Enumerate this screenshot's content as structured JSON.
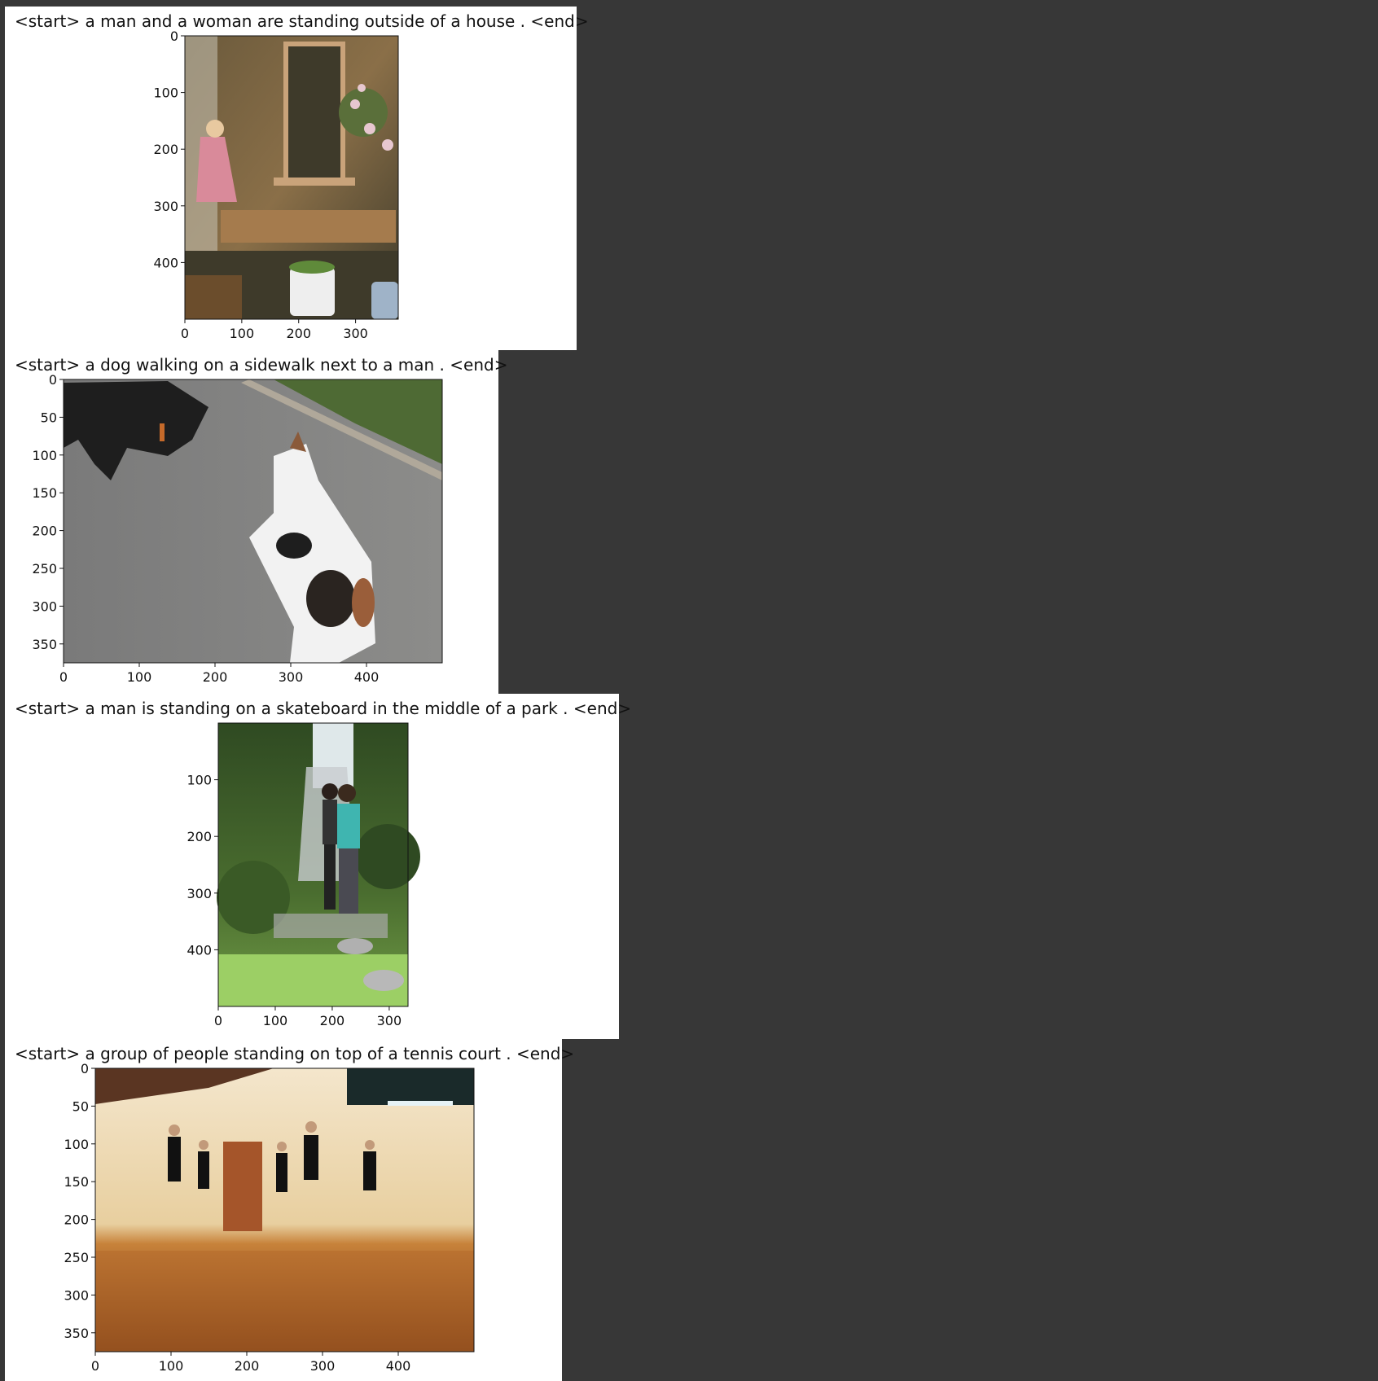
{
  "colors": {
    "background": "#373737",
    "panel": "#ffffff",
    "axis": "#111111"
  },
  "figures": [
    {
      "caption": "<start> a man and a woman are standing outside of a house . <end>",
      "image_subject": "girl in pink dress climbing steps of a wooden cabin porch with flowers and buckets",
      "palette": [
        "#6b5a3c",
        "#8a6f48",
        "#3e3a2a",
        "#c9a37a",
        "#e7c7d0",
        "#5a6f3a"
      ],
      "chart_data": {
        "type": "table",
        "x_ticks": [
          0,
          100,
          200,
          300
        ],
        "y_ticks": [
          0,
          100,
          200,
          300,
          400
        ],
        "xlim": [
          0,
          375
        ],
        "ylim": [
          500,
          0
        ]
      }
    },
    {
      "caption": "<start> a dog walking on a sidewalk next to a man . <end>",
      "image_subject": "black dog and black-and-white dog playing on asphalt road beside grass",
      "palette": [
        "#7a7a7a",
        "#8c8c8a",
        "#1e1e1e",
        "#f2f2f2",
        "#4e6a34",
        "#9a8e80"
      ],
      "chart_data": {
        "type": "table",
        "x_ticks": [
          0,
          100,
          200,
          300,
          400
        ],
        "y_ticks": [
          0,
          50,
          100,
          150,
          200,
          250,
          300,
          350
        ],
        "xlim": [
          0,
          500
        ],
        "ylim": [
          375,
          0
        ]
      }
    },
    {
      "caption": "<start> a man is standing on a skateboard in the middle of a park . <end>",
      "image_subject": "two young people standing on stone path in a green garden",
      "palette": [
        "#2f4a22",
        "#4a6d2f",
        "#6f9a45",
        "#9ccf65",
        "#3fb5b0",
        "#a9a9a9"
      ],
      "chart_data": {
        "type": "table",
        "x_ticks": [
          0,
          100,
          200,
          300
        ],
        "y_ticks": [
          100,
          200,
          300,
          400
        ],
        "xlim": [
          0,
          333
        ],
        "ylim": [
          500,
          0
        ]
      }
    },
    {
      "caption": "<start> a group of people standing on top of a tennis court . <end>",
      "image_subject": "ballet dancers in black leotards jumping in a studio with wooden floor",
      "palette": [
        "#f4e6cc",
        "#e8cf9f",
        "#a85a1e",
        "#c7823a",
        "#6d3210",
        "#111111"
      ],
      "chart_data": {
        "type": "table",
        "x_ticks": [
          0,
          100,
          200,
          300,
          400
        ],
        "y_ticks": [
          0,
          50,
          100,
          150,
          200,
          250,
          300,
          350
        ],
        "xlim": [
          0,
          500
        ],
        "ylim": [
          375,
          0
        ]
      }
    }
  ]
}
